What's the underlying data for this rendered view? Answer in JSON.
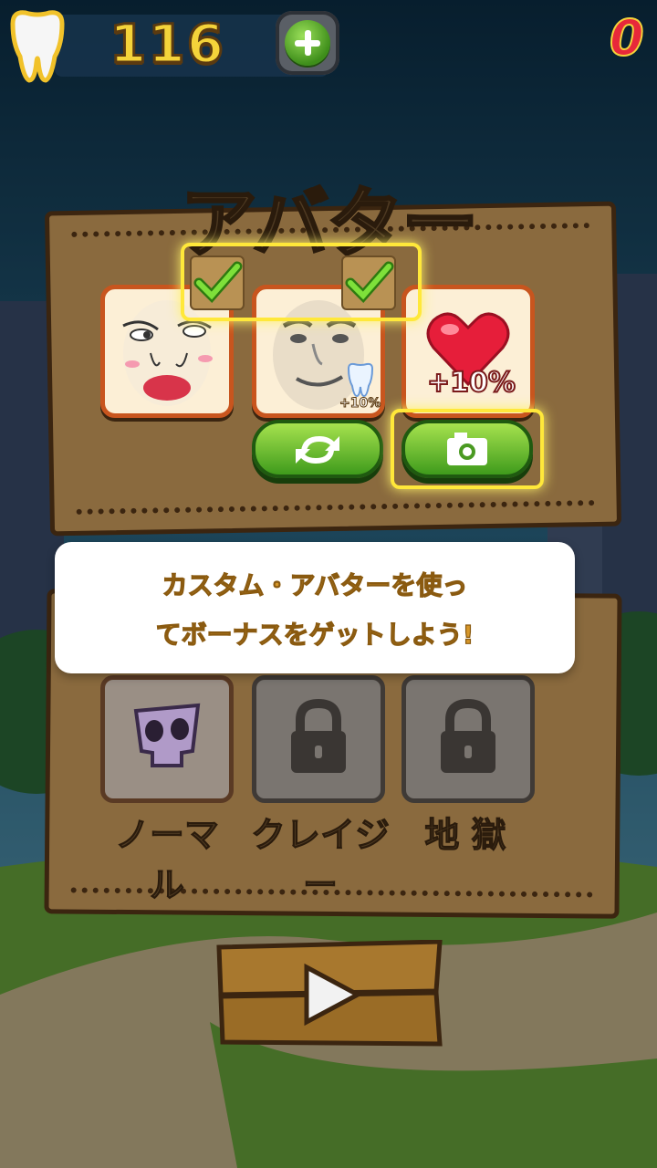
{
  "hud": {
    "coins": "116",
    "right_counter": "0",
    "icons": {
      "currency": "tooth-icon",
      "add": "plus-icon"
    }
  },
  "avatar_panel": {
    "title": "アバター",
    "cards": [
      {
        "name": "face-avatar-1",
        "selected": true
      },
      {
        "name": "face-avatar-2",
        "selected": true,
        "badge": "+10%"
      },
      {
        "name": "heart-bonus",
        "label": "+10%"
      }
    ],
    "buttons": {
      "refresh_icon": "refresh-icon",
      "camera_icon": "camera-icon"
    }
  },
  "tooltip": {
    "line1": "カスタム・アバターを使っ",
    "line2": "てボーナスをゲットしよう!"
  },
  "difficulty": {
    "levels": [
      {
        "label": "ノーマル",
        "locked": false,
        "icon": "skull-icon"
      },
      {
        "label": "クレイジー",
        "locked": true,
        "icon": "lock-icon"
      },
      {
        "label": "地 獄",
        "locked": true,
        "icon": "lock-icon"
      }
    ]
  },
  "play_button": {
    "icon": "play-icon"
  },
  "colors": {
    "accent_green": "#3f9b1c",
    "panel_brown": "#8a6a3e",
    "highlight_yellow": "#ffe83a",
    "tooltip_text": "#d6972a"
  }
}
